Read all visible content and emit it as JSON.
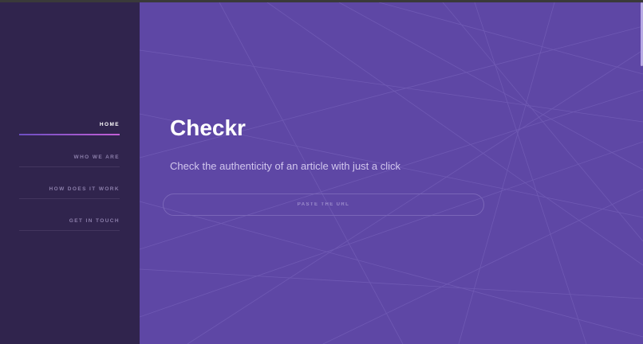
{
  "sidebar": {
    "items": [
      {
        "label": "HOME",
        "active": true
      },
      {
        "label": "WHO WE ARE",
        "active": false
      },
      {
        "label": "HOW DOES IT WORK",
        "active": false
      },
      {
        "label": "GET IN TOUCH",
        "active": false
      }
    ]
  },
  "main": {
    "title": "Checkr",
    "tagline": "Check the authenticity of an article with just a click",
    "url_input": {
      "placeholder": "PASTE THE URL",
      "value": ""
    }
  },
  "colors": {
    "sidebar_bg": "#30244d",
    "main_bg": "#5e47a5",
    "active_underline_start": "#6d4fc2",
    "active_underline_end": "#c45fd6"
  }
}
